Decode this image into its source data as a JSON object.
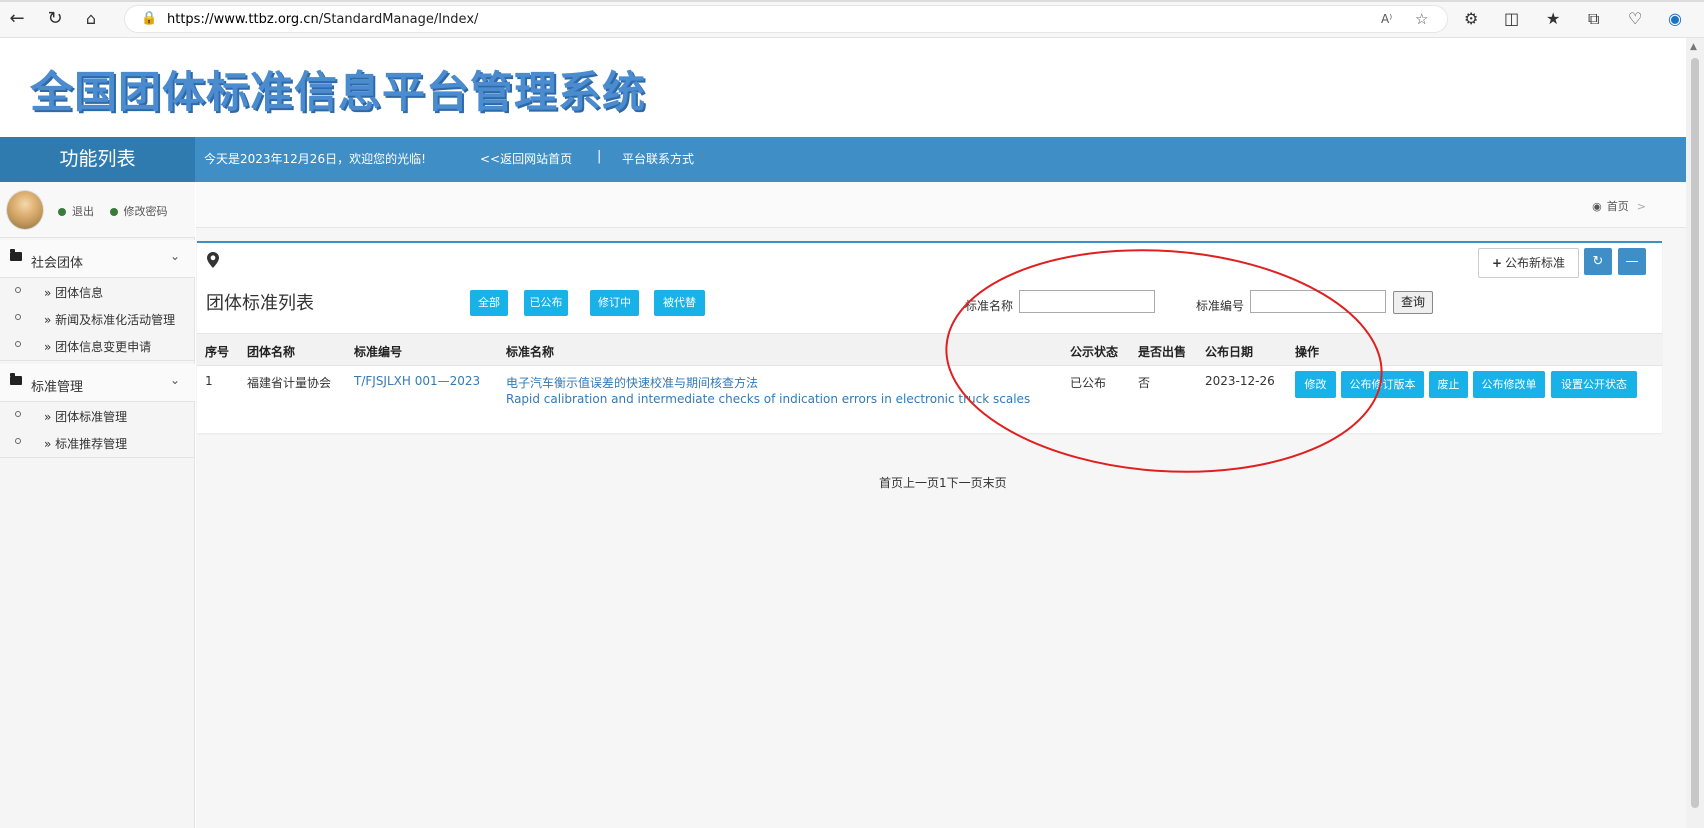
{
  "browser": {
    "url_host": "https://www.ttbz.org.cn",
    "url_path": "/StandardManage/Index/",
    "read_aloud_label": "A⁾"
  },
  "header": {
    "site_title": "全国团体标准信息平台管理系统"
  },
  "topnav": {
    "menu_title": "功能列表",
    "welcome": "今天是2023年12月26日，欢迎您的光临!",
    "back_link": "<<返回网站首页",
    "separator": "|",
    "contact_link": "平台联系方式"
  },
  "sidebar": {
    "logout": "退出",
    "change_password": "修改密码",
    "groups": [
      {
        "label": "社会团体",
        "items": [
          "» 团体信息",
          "» 新闻及标准化活动管理",
          "» 团体信息变更申请"
        ]
      },
      {
        "label": "标准管理",
        "items": [
          "» 团体标准管理",
          "» 标准推荐管理"
        ]
      }
    ]
  },
  "breadcrumb": {
    "home": "首页",
    "arrow": ">"
  },
  "widget": {
    "title": "团体标准列表",
    "publish_new": "公布新标准",
    "filters": [
      "全部",
      "已公布",
      "修订中",
      "被代替"
    ],
    "search": {
      "name_label": "标准名称",
      "name_value": "",
      "code_label": "标准编号",
      "code_value": "",
      "query_button": "查询"
    }
  },
  "table": {
    "columns": [
      "序号",
      "团体名称",
      "标准编号",
      "标准名称",
      "公示状态",
      "是否出售",
      "公布日期",
      "操作"
    ],
    "rows": [
      {
        "index": "1",
        "org": "福建省计量协会",
        "code": "T/FJSJLXH 001—2023",
        "name_cn": "电子汽车衡示值误差的快速校准与期间核查方法",
        "name_en": "Rapid calibration and intermediate checks of indication errors in electronic truck scales",
        "status": "已公布",
        "for_sale": "否",
        "date": "2023-12-26",
        "actions": [
          "修改",
          "公布修订版本",
          "废止",
          "公布修改单",
          "设置公开状态"
        ]
      }
    ]
  },
  "pager": {
    "text": "首页上一页1下一页末页"
  },
  "colors": {
    "brand_blue": "#3f8ec5",
    "button_cyan": "#18b2e8",
    "annotation_red": "#e02020"
  }
}
